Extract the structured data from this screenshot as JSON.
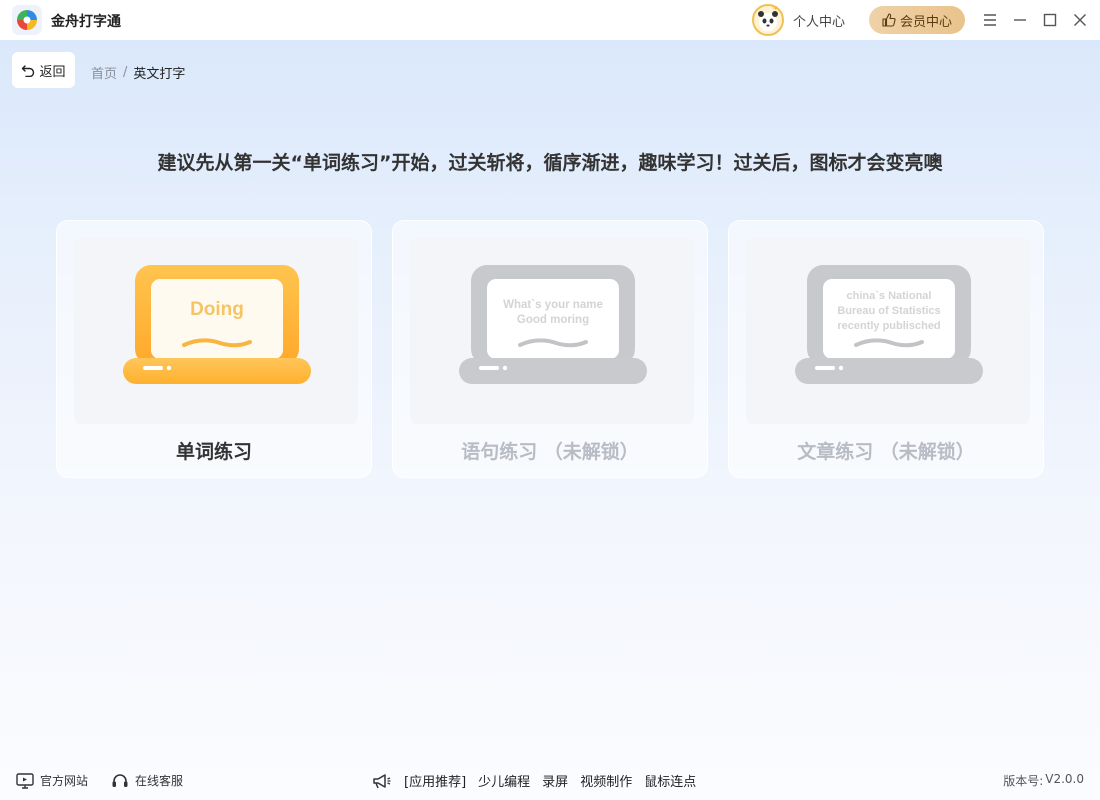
{
  "app": {
    "name": "金舟打字通",
    "personal_center": "个人中心",
    "vip_center": "会员中心"
  },
  "nav": {
    "back_label": "返回",
    "breadcrumb_home": "首页",
    "breadcrumb_separator": "/",
    "breadcrumb_current": "英文打字"
  },
  "hint": "建议先从第一关“单词练习”开始，过关斩将，循序渐进，趣味学习！过关后，图标才会变亮噢",
  "cards": [
    {
      "label": "单词练习",
      "status": "active",
      "screen_lines": [
        "Doing"
      ]
    },
    {
      "label": "语句练习 （未解锁）",
      "status": "locked",
      "screen_lines": [
        "What`s your name",
        "Good moring"
      ]
    },
    {
      "label": "文章练习 （未解锁）",
      "status": "locked",
      "screen_lines": [
        "china`s National",
        "Bureau of Statistics",
        "recently publisched"
      ]
    }
  ],
  "footer": {
    "website": "官方网站",
    "support": "在线客服",
    "promo_title": "[应用推荐]",
    "promo_links": [
      "少儿编程",
      "录屏",
      "视频制作",
      "鼠标连点"
    ],
    "version_label": "版本号:",
    "version_value": "V2.0.0"
  },
  "colors": {
    "accent_orange": "#ffb43a",
    "locked_gray": "#c4c6ca",
    "vip_gold": "#e9c38c"
  }
}
